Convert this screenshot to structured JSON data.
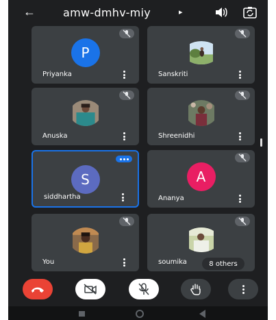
{
  "header": {
    "meeting_code": "amw-dmhv-miy",
    "back_icon": "arrow-back-icon",
    "caret_icon": "caret-right-icon",
    "speaker_icon": "speaker-icon",
    "switch_camera_icon": "switch-camera-icon"
  },
  "participants": [
    {
      "name": "Priyanka",
      "avatar_letter": "P",
      "avatar_color": "#1a73e8",
      "muted": true
    },
    {
      "name": "Sanskriti",
      "photo": true,
      "muted": true
    },
    {
      "name": "Anuska",
      "photo": true,
      "muted": true
    },
    {
      "name": "Shreenidhi",
      "photo": true,
      "muted": true
    },
    {
      "name": "siddhartha",
      "avatar_letter": "S",
      "avatar_color": "#5c6bc0",
      "speaking": true
    },
    {
      "name": "Ananya",
      "avatar_letter": "A",
      "avatar_color": "#e91e63",
      "muted": true
    },
    {
      "name": "You",
      "photo": true,
      "muted": true
    },
    {
      "name": "soumika",
      "photo": true,
      "muted": true
    }
  ],
  "overflow": {
    "label": "8 others"
  },
  "controls": {
    "end_call_icon": "end-call-icon",
    "camera_off_icon": "camera-off-icon",
    "mic_off_icon": "mic-off-icon",
    "raise_hand_icon": "raise-hand-icon",
    "more_icon": "more-vertical-icon"
  },
  "colors": {
    "background": "#1e1f21",
    "tile": "#3c4043",
    "end_call": "#ea4335",
    "active_speaker": "#1a73e8"
  }
}
